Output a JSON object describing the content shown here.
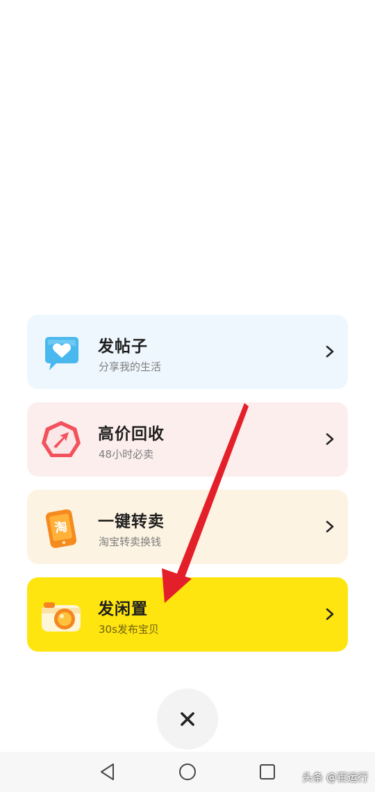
{
  "menu": {
    "items": [
      {
        "title": "发帖子",
        "subtitle": "分享我的生活",
        "icon": "heart-bubble-icon"
      },
      {
        "title": "高价回收",
        "subtitle": "48小时必卖",
        "icon": "recycle-arrow-icon"
      },
      {
        "title": "一键转卖",
        "subtitle": "淘宝转卖换钱",
        "icon": "taobao-phone-icon",
        "icon_char": "淘"
      },
      {
        "title": "发闲置",
        "subtitle": "30s发布宝贝",
        "icon": "camera-icon"
      }
    ]
  },
  "close_button": {
    "icon": "close-icon"
  },
  "navbar": {
    "back": "back-triangle-icon",
    "home": "home-circle-icon",
    "recents": "recents-square-icon"
  },
  "watermark": "头条 @百运行",
  "colors": {
    "card_blue": "#eef7fd",
    "card_pink": "#fdeeee",
    "card_cream": "#fdf3e2",
    "card_yellow": "#fee50f",
    "annotation_arrow": "#e3202a"
  }
}
